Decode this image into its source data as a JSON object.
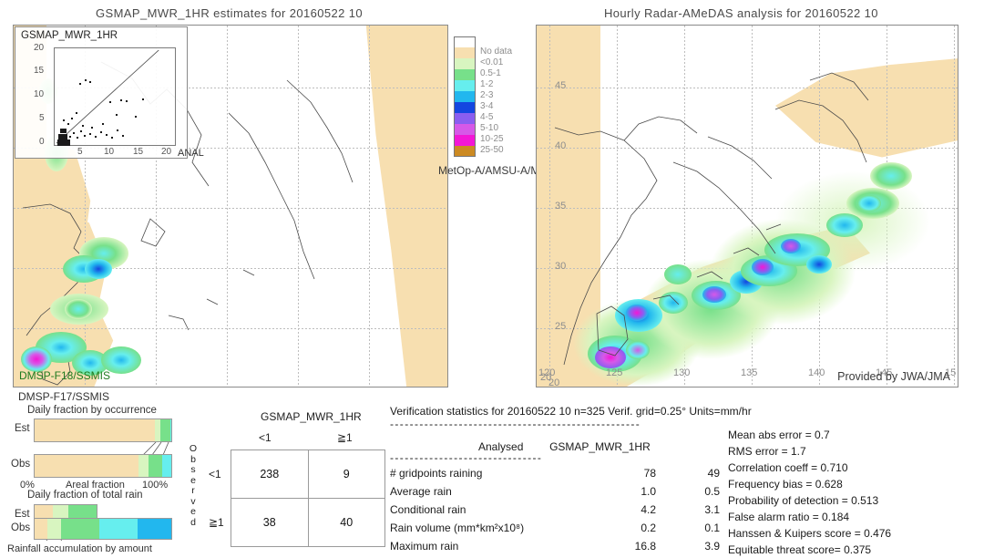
{
  "titles": {
    "left": "GSMAP_MWR_1HR estimates for 20160522 10",
    "right": "Hourly Radar-AMeDAS analysis for 20160522 10"
  },
  "left_map": {
    "satellite_primary": "DMSP-F18/SSMIS",
    "satellite_secondary": "DMSP-F17/SSMIS",
    "sensor_note": "MetOp-A/AMSU-A/M"
  },
  "right_map": {
    "provider": "Provided by JWA/JMA",
    "lon_ticks": [
      "120",
      "125",
      "130",
      "135",
      "140",
      "145",
      "15"
    ],
    "lat_ticks": [
      "45",
      "40",
      "35",
      "30",
      "25",
      "20"
    ],
    "corner_lon": "20"
  },
  "legend": {
    "entries": [
      {
        "label": "",
        "color": "#ffffff"
      },
      {
        "label": "No data",
        "color": "#f7dfb0"
      },
      {
        "label": "<0.01",
        "color": "#d8f5c0"
      },
      {
        "label": "0.5-1",
        "color": "#77e08a"
      },
      {
        "label": "1-2",
        "color": "#66eeee"
      },
      {
        "label": "2-3",
        "color": "#22b7ee"
      },
      {
        "label": "3-4",
        "color": "#1446e0"
      },
      {
        "label": "4-5",
        "color": "#8a5ef0"
      },
      {
        "label": "5-10",
        "color": "#d659e8"
      },
      {
        "label": "10-25",
        "color": "#f317d6"
      },
      {
        "label": "25-50",
        "color": "#cc8a22"
      }
    ]
  },
  "inset": {
    "title": "GSMAP_MWR_1HR",
    "xlabel": "ANAL",
    "yticks": [
      "20",
      "15",
      "10",
      "5",
      "0"
    ],
    "xticks": [
      "5",
      "10",
      "15",
      "20"
    ]
  },
  "occurrence_panel": {
    "title": "Daily fraction by occurrence",
    "row_est": "Est",
    "row_obs": "Obs",
    "axis_left": "0%",
    "axis_center": "Areal fraction",
    "axis_right": "100%",
    "est_segments": [
      {
        "color": "#f7dfb0",
        "pct": 88
      },
      {
        "color": "#d8f5c0",
        "pct": 4
      },
      {
        "color": "#77e08a",
        "pct": 7
      },
      {
        "color": "#66eeee",
        "pct": 1
      }
    ],
    "obs_segments": [
      {
        "color": "#f7dfb0",
        "pct": 76
      },
      {
        "color": "#d8f5c0",
        "pct": 7
      },
      {
        "color": "#77e08a",
        "pct": 10
      },
      {
        "color": "#66eeee",
        "pct": 7
      }
    ]
  },
  "amount_panel": {
    "title": "Daily fraction of total rain",
    "caption": "Rainfall accumulation by amount",
    "row_est": "Est",
    "row_obs": "Obs",
    "est_segments": [
      {
        "color": "#f7dfb0",
        "pct": 14
      },
      {
        "color": "#d8f5c0",
        "pct": 11
      },
      {
        "color": "#77e08a",
        "pct": 21
      }
    ],
    "obs_segments": [
      {
        "color": "#f7dfb0",
        "pct": 9
      },
      {
        "color": "#d8f5c0",
        "pct": 10
      },
      {
        "color": "#77e08a",
        "pct": 28
      },
      {
        "color": "#66eeee",
        "pct": 28
      },
      {
        "color": "#22b7ee",
        "pct": 25
      }
    ]
  },
  "contingency": {
    "title": "GSMAP_MWR_1HR",
    "col_headers": [
      "<1",
      "≧1"
    ],
    "row_headers": [
      "<1",
      "≧1"
    ],
    "observed_label": "Observed",
    "cells": [
      [
        "238",
        "9"
      ],
      [
        "38",
        "40"
      ]
    ]
  },
  "verification": {
    "header": "Verification statistics for 20160522 10  n=325  Verif. grid=0.25°  Units=mm/hr",
    "rule": "---------------------------------------------------",
    "sub_rule": "-------------------------------",
    "col_analysed": "Analysed",
    "col_estimate": "GSMAP_MWR_1HR",
    "rows": [
      {
        "label": "# gridpoints raining",
        "analysed": "78",
        "estimate": "49"
      },
      {
        "label": "Average rain",
        "analysed": "1.0",
        "estimate": "0.5"
      },
      {
        "label": "Conditional rain",
        "analysed": "4.2",
        "estimate": "3.1"
      },
      {
        "label": "Rain volume (mm*km²x10⁸)",
        "analysed": "0.2",
        "estimate": "0.1"
      },
      {
        "label": "Maximum rain",
        "analysed": "16.8",
        "estimate": "3.9"
      }
    ],
    "scores": [
      "Mean abs error = 0.7",
      "RMS error = 1.7",
      "Correlation coeff = 0.710",
      "Frequency bias = 0.628",
      "Probability of detection = 0.513",
      "False alarm ratio = 0.184",
      "Hanssen & Kuipers score = 0.476",
      "Equitable threat score= 0.375"
    ]
  }
}
